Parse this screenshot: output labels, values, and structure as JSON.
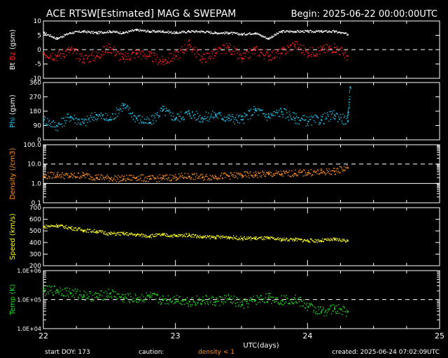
{
  "title": "ACE RTSW[Estimated] MAG & SWEPAM",
  "begin": "Begin: 2025-06-22 00:00:00UTC",
  "footer": {
    "start_doy": "start DOY: 173",
    "caution": "caution:",
    "density_note": "density < 1",
    "created": "created: 2025-06-24 07:02:09UTC"
  },
  "colors": {
    "bt": "#ffffff",
    "bz": "#ff2020",
    "phi": "#20c8f0",
    "density": "#ff9020",
    "speed": "#ffff20",
    "temp": "#20e020",
    "density_note": "#ff9020"
  },
  "chart_data": [
    {
      "type": "scatter",
      "panel": "mag",
      "ylabel_parts": [
        "Bt",
        "Bz",
        "(gsm)"
      ],
      "yticks": [
        "10",
        "5",
        "0",
        "-5",
        "-10"
      ],
      "ylim": [
        -10,
        10
      ],
      "xlim": [
        22.0,
        25.0
      ],
      "dashed_ref": [
        0
      ],
      "series": [
        {
          "name": "Bt",
          "x": [
            22.0,
            22.1,
            22.2,
            22.3,
            22.4,
            22.5,
            22.6,
            22.7,
            22.8,
            22.9,
            23.0,
            23.1,
            23.2,
            23.3,
            23.4,
            23.5,
            23.6,
            23.7,
            23.8,
            23.9,
            24.0,
            24.1,
            24.2,
            24.3
          ],
          "y": [
            6,
            4,
            6,
            6.5,
            6,
            6.5,
            6,
            7,
            6.5,
            6.5,
            6,
            6.5,
            6.5,
            6,
            6,
            5.5,
            6,
            4,
            6.5,
            6.5,
            6.5,
            6.5,
            6.5,
            5.5
          ]
        },
        {
          "name": "Bz",
          "x": [
            22.0,
            22.1,
            22.2,
            22.3,
            22.4,
            22.5,
            22.6,
            22.7,
            22.8,
            22.9,
            23.0,
            23.1,
            23.2,
            23.3,
            23.4,
            23.5,
            23.6,
            23.7,
            23.8,
            23.9,
            24.0,
            24.1,
            24.2,
            24.3
          ],
          "y": [
            -1,
            -2,
            0,
            -3,
            -2,
            1,
            -3,
            -1,
            -2,
            -4,
            -2,
            2,
            -3,
            -1,
            1,
            -3,
            0,
            -2,
            -1,
            2,
            -1,
            0,
            1,
            -2
          ]
        }
      ]
    },
    {
      "type": "scatter",
      "panel": "phi",
      "ylabel_parts": [
        "Phi",
        "(gsm)"
      ],
      "yticks": [
        "360",
        "270",
        "180",
        "90",
        "0"
      ],
      "ylim": [
        0,
        360
      ],
      "xlim": [
        22.0,
        25.0
      ],
      "series": [
        {
          "name": "Phi",
          "x": [
            22.0,
            22.1,
            22.2,
            22.3,
            22.4,
            22.5,
            22.6,
            22.7,
            22.8,
            22.9,
            23.0,
            23.1,
            23.2,
            23.3,
            23.4,
            23.5,
            23.6,
            23.7,
            23.8,
            23.9,
            24.0,
            24.1,
            24.2,
            24.3,
            24.32
          ],
          "y": [
            130,
            90,
            150,
            110,
            160,
            130,
            220,
            140,
            110,
            190,
            140,
            170,
            140,
            160,
            140,
            130,
            190,
            150,
            180,
            140,
            120,
            130,
            160,
            120,
            330
          ]
        }
      ]
    },
    {
      "type": "scatter",
      "panel": "density",
      "ylabel": "Density (/cm3)",
      "yscale": "log",
      "yticks": [
        "100.0",
        "10.0",
        "1.0",
        "0.1"
      ],
      "ylim": [
        0.1,
        100
      ],
      "xlim": [
        22.0,
        25.0
      ],
      "dashed_ref": [
        10
      ],
      "solid_ref": [
        1
      ],
      "series": [
        {
          "name": "Density",
          "x": [
            22.0,
            22.1,
            22.2,
            22.3,
            22.4,
            22.5,
            22.6,
            22.7,
            22.8,
            22.9,
            23.0,
            23.1,
            23.2,
            23.3,
            23.4,
            23.5,
            23.6,
            23.7,
            23.8,
            23.9,
            24.0,
            24.1,
            24.2,
            24.3
          ],
          "y": [
            2.5,
            3,
            2.5,
            2.8,
            2.2,
            2.0,
            1.8,
            2.2,
            1.8,
            2.0,
            2.2,
            2.5,
            2.2,
            2.4,
            2.6,
            2.8,
            3.0,
            3.2,
            3.3,
            3.5,
            3.8,
            4.0,
            4.5,
            7.0
          ]
        }
      ]
    },
    {
      "type": "scatter",
      "panel": "speed",
      "ylabel": "Speed (km/s)",
      "yticks": [
        "700",
        "600",
        "500",
        "400",
        "300",
        "200"
      ],
      "ylim": [
        200,
        700
      ],
      "xlim": [
        22.0,
        25.0
      ],
      "series": [
        {
          "name": "Speed",
          "x": [
            22.0,
            22.1,
            22.2,
            22.3,
            22.4,
            22.5,
            22.6,
            22.7,
            22.8,
            22.9,
            23.0,
            23.1,
            23.2,
            23.3,
            23.4,
            23.5,
            23.6,
            23.7,
            23.8,
            23.9,
            24.0,
            24.1,
            24.2,
            24.3
          ],
          "y": [
            540,
            550,
            530,
            510,
            500,
            480,
            480,
            470,
            460,
            470,
            460,
            470,
            450,
            450,
            450,
            440,
            440,
            440,
            430,
            430,
            420,
            420,
            430,
            420
          ]
        }
      ]
    },
    {
      "type": "scatter",
      "panel": "temp",
      "ylabel": "Temp (K)",
      "yscale": "log",
      "yticks": [
        "1.0E+06",
        "1.0E+05",
        "1.0E+04"
      ],
      "ylim": [
        10000,
        1000000
      ],
      "xlim": [
        22.0,
        25.0
      ],
      "dashed_ref": [
        100000
      ],
      "xticks": [
        "22",
        "23",
        "24",
        "25"
      ],
      "xlabel": "UTC(days)",
      "series": [
        {
          "name": "Temp",
          "x": [
            22.0,
            22.1,
            22.2,
            22.3,
            22.4,
            22.5,
            22.6,
            22.7,
            22.8,
            22.9,
            23.0,
            23.1,
            23.2,
            23.3,
            23.4,
            23.5,
            23.6,
            23.7,
            23.8,
            23.9,
            24.0,
            24.1,
            24.2,
            24.3
          ],
          "y": [
            200000,
            220000,
            180000,
            150000,
            130000,
            170000,
            120000,
            110000,
            130000,
            100000,
            110000,
            90000,
            100000,
            90000,
            110000,
            70000,
            100000,
            120000,
            100000,
            110000,
            60000,
            40000,
            50000,
            40000
          ]
        }
      ]
    }
  ]
}
